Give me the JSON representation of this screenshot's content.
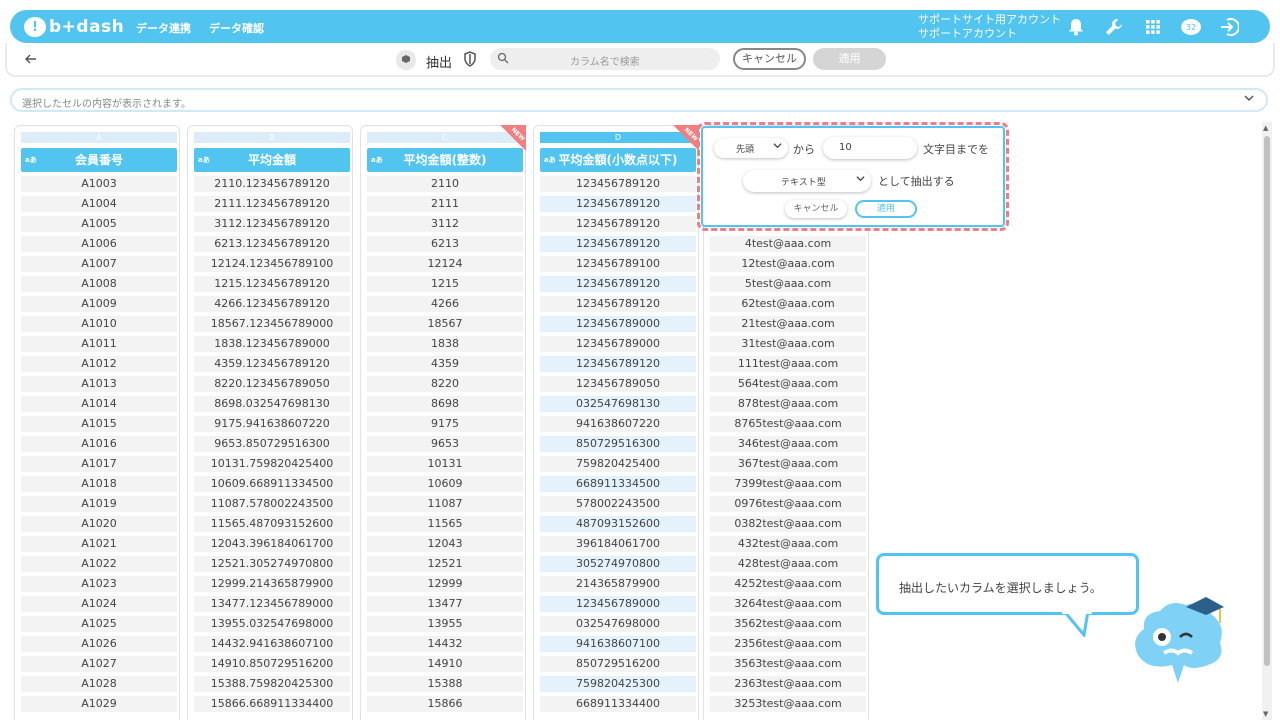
{
  "header": {
    "logo_text": "b+dash",
    "nav": [
      "データ連携",
      "データ確認"
    ],
    "account_line1": "サポートサイト用アカウント",
    "account_line2": "サポートアカウント",
    "badge_count": "32",
    "accent_color": "#52c4f0"
  },
  "toolbar": {
    "back_icon": "arrow-left-icon",
    "mode_label": "抽出",
    "search_placeholder": "カラム名で検索",
    "cancel_label": "キャンセル",
    "apply_label": "適用"
  },
  "cellbar": {
    "placeholder": "選択したセルの内容が表示されます。"
  },
  "columns": [
    {
      "letter": "A",
      "type": "aあ",
      "name": "会員番号",
      "new": false,
      "rows": [
        "A1003",
        "A1004",
        "A1005",
        "A1006",
        "A1007",
        "A1008",
        "A1009",
        "A1010",
        "A1011",
        "A1012",
        "A1013",
        "A1014",
        "A1015",
        "A1016",
        "A1017",
        "A1018",
        "A1019",
        "A1020",
        "A1021",
        "A1022",
        "A1023",
        "A1024",
        "A1025",
        "A1026",
        "A1027",
        "A1028",
        "A1029"
      ]
    },
    {
      "letter": "B",
      "type": "aあ",
      "name": "平均金額",
      "new": false,
      "rows": [
        "2110.123456789120",
        "2111.123456789120",
        "3112.123456789120",
        "6213.123456789120",
        "12124.123456789100",
        "1215.123456789120",
        "4266.123456789120",
        "18567.123456789000",
        "1838.123456789000",
        "4359.123456789120",
        "8220.123456789050",
        "8698.032547698130",
        "9175.941638607220",
        "9653.850729516300",
        "10131.759820425400",
        "10609.668911334500",
        "11087.578002243500",
        "11565.487093152600",
        "12043.396184061700",
        "12521.305274970800",
        "12999.214365879900",
        "13477.123456789000",
        "13955.032547698000",
        "14432.941638607100",
        "14910.850729516200",
        "15388.759820425300",
        "15866.668911334400"
      ]
    },
    {
      "letter": "C",
      "type": "aあ",
      "name": "平均金額(整数)",
      "new": true,
      "rows": [
        "2110",
        "2111",
        "3112",
        "6213",
        "12124",
        "1215",
        "4266",
        "18567",
        "1838",
        "4359",
        "8220",
        "8698",
        "9175",
        "9653",
        "10131",
        "10609",
        "11087",
        "11565",
        "12043",
        "12521",
        "12999",
        "13477",
        "13955",
        "14432",
        "14910",
        "15388",
        "15866"
      ]
    },
    {
      "letter": "D",
      "type": "aあ",
      "name": "平均金額(小数点以下)",
      "new": true,
      "rows": [
        "123456789120",
        "123456789120",
        "123456789120",
        "123456789120",
        "123456789100",
        "123456789120",
        "123456789120",
        "123456789000",
        "123456789000",
        "123456789120",
        "123456789050",
        "032547698130",
        "941638607220",
        "850729516300",
        "759820425400",
        "668911334500",
        "578002243500",
        "487093152600",
        "396184061700",
        "305274970800",
        "214365879900",
        "123456789000",
        "032547698000",
        "941638607100",
        "850729516200",
        "759820425300",
        "668911334400"
      ]
    }
  ],
  "email_rows": [
    "4test@aaa.com",
    "12test@aaa.com",
    "5test@aaa.com",
    "62test@aaa.com",
    "21test@aaa.com",
    "31test@aaa.com",
    "111test@aaa.com",
    "564test@aaa.com",
    "878test@aaa.com",
    "8765test@aaa.com",
    "346test@aaa.com",
    "367test@aaa.com",
    "7399test@aaa.com",
    "0976test@aaa.com",
    "0382test@aaa.com",
    "432test@aaa.com",
    "428test@aaa.com",
    "4252test@aaa.com",
    "3264test@aaa.com",
    "3562test@aaa.com",
    "2356test@aaa.com",
    "3563test@aaa.com",
    "2363test@aaa.com",
    "3253test@aaa.com"
  ],
  "popup": {
    "position_select": "先頭",
    "from_label": "から",
    "char_count": "10",
    "until_label": "文字目までを",
    "type_select": "テキスト型",
    "extract_as_label": "として抽出する",
    "cancel_label": "キャンセル",
    "apply_label": "適用"
  },
  "assistant": {
    "message": "抽出したいカラムを選択しましょう。"
  }
}
